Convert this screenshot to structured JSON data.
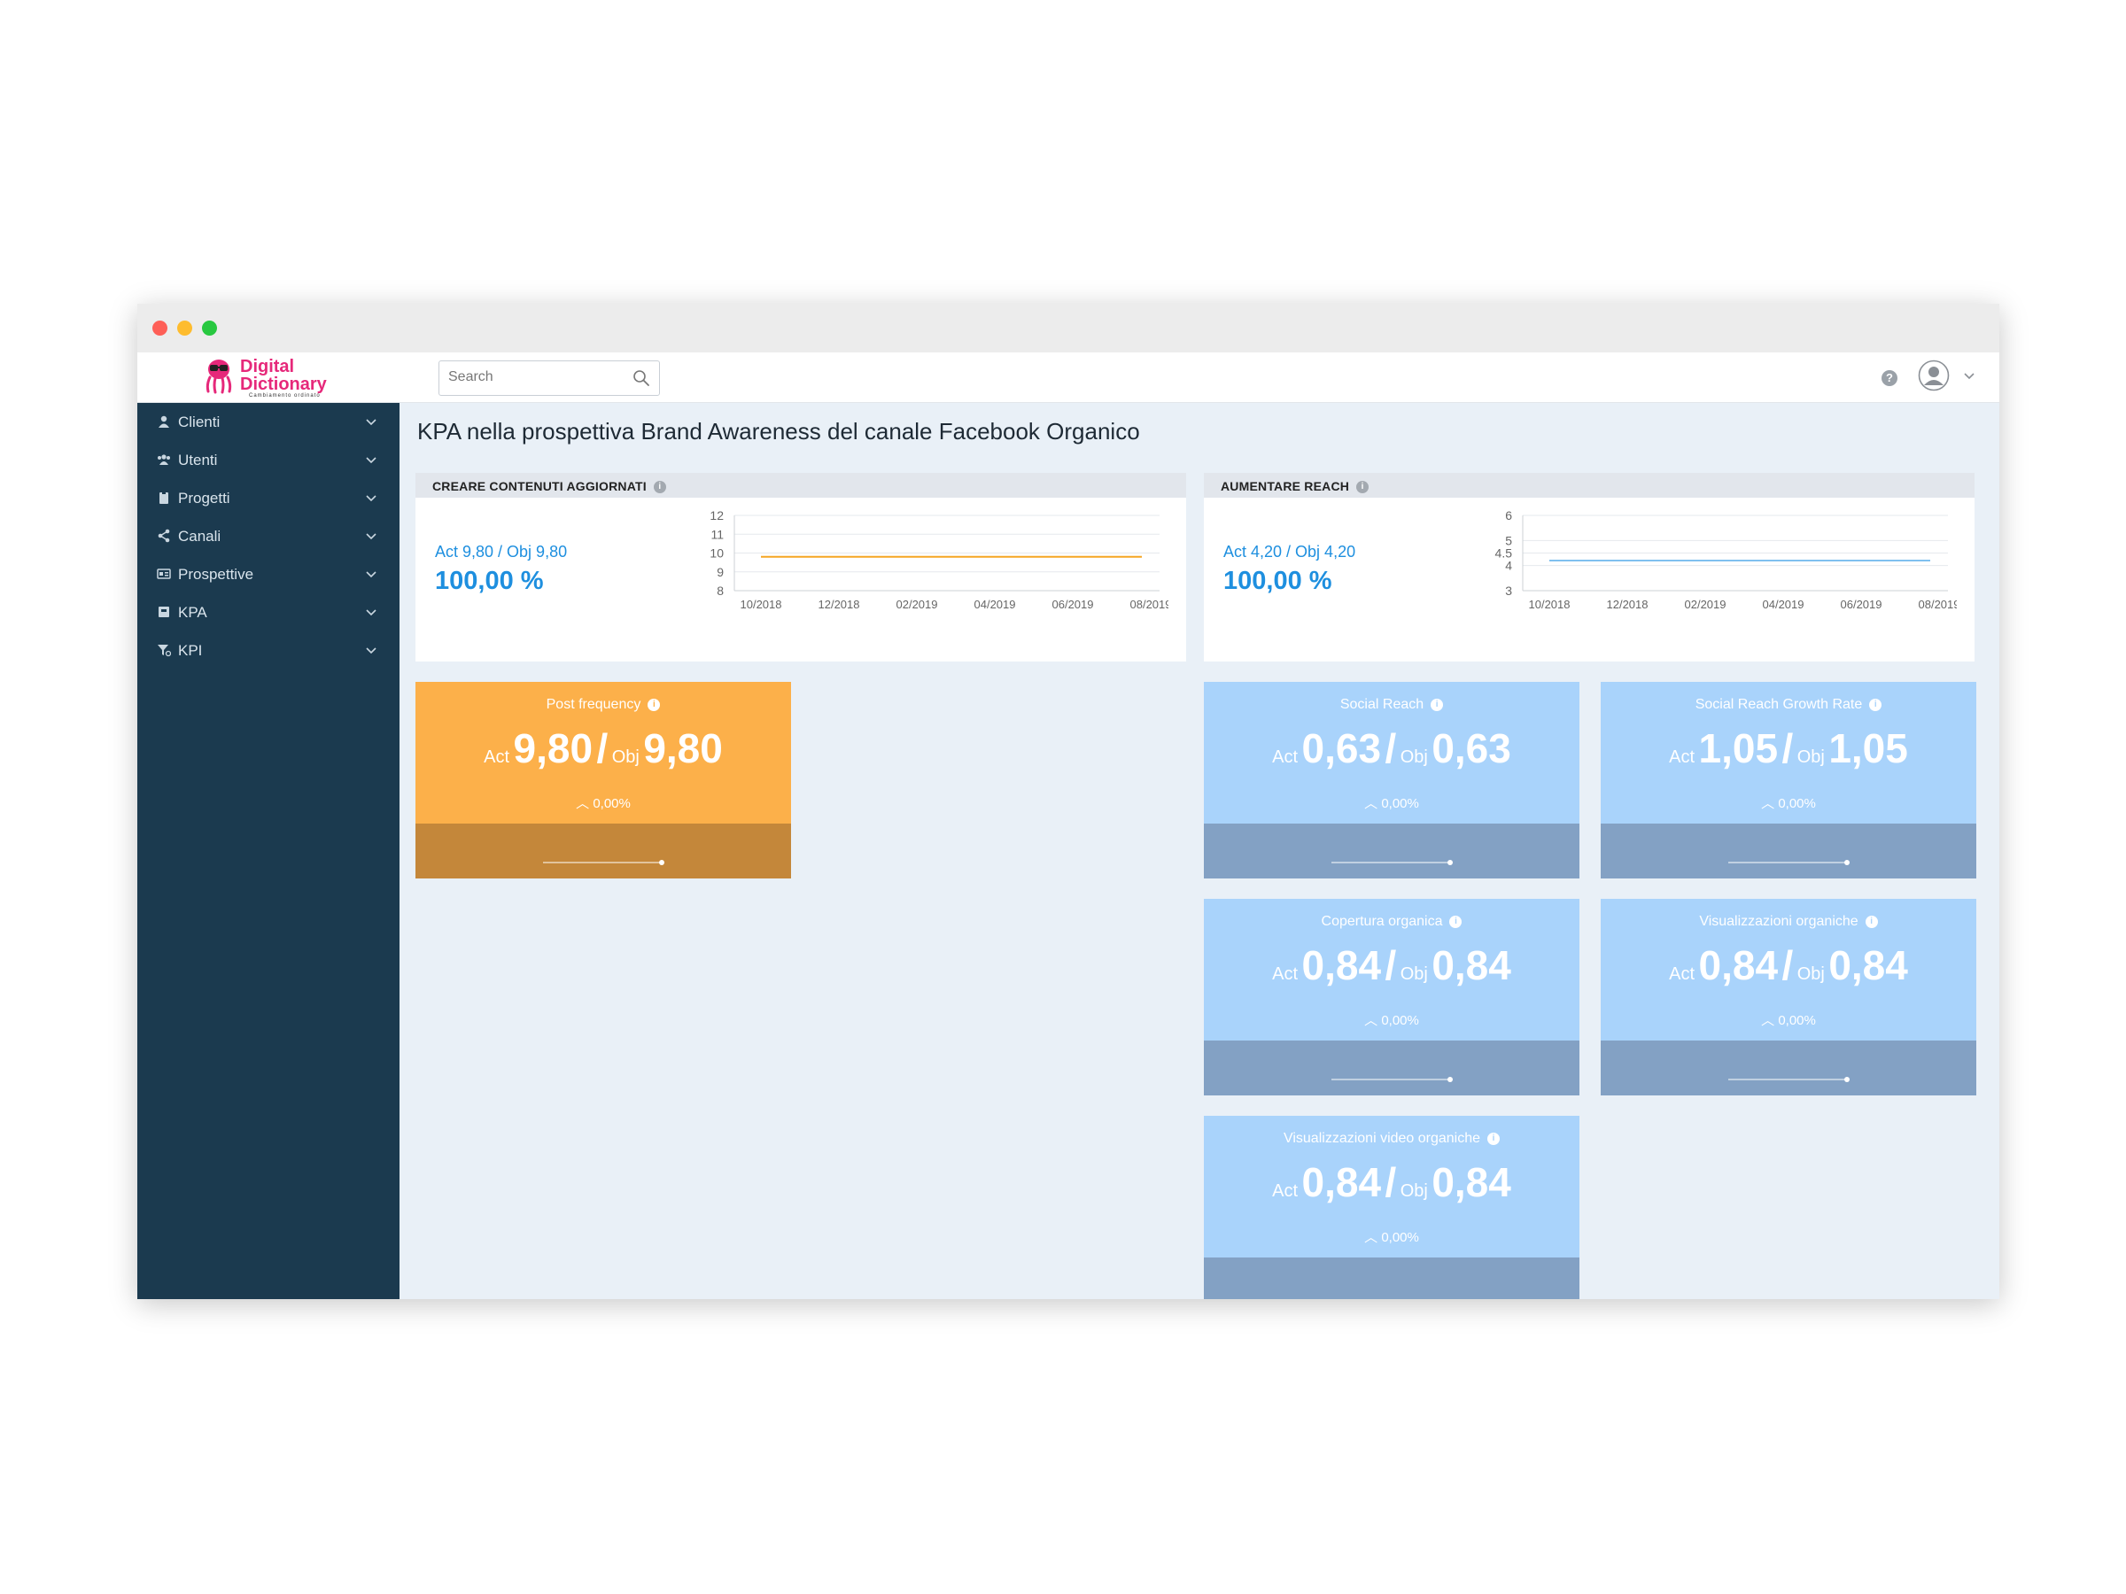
{
  "header": {
    "logo_line1": "Digital",
    "logo_line2": "Dictionary",
    "logo_tagline": "Cambiamento ordinato",
    "search_placeholder": "Search",
    "help_glyph": "?"
  },
  "sidebar": {
    "items": [
      {
        "label": "Clienti",
        "icon": "user-icon"
      },
      {
        "label": "Utenti",
        "icon": "users-icon"
      },
      {
        "label": "Progetti",
        "icon": "clipboard-icon"
      },
      {
        "label": "Canali",
        "icon": "share-icon"
      },
      {
        "label": "Prospettive",
        "icon": "id-card-icon"
      },
      {
        "label": "KPA",
        "icon": "book-icon"
      },
      {
        "label": "KPI",
        "icon": "funnel-icon"
      }
    ]
  },
  "page": {
    "title": "KPA nella prospettiva Brand Awareness del canale Facebook Organico"
  },
  "kpa_cards": [
    {
      "title": "CREARE CONTENUTI AGGIORNATI",
      "act_obj": "Act 9,80 / Obj 9,80",
      "percent": "100,00 %",
      "y_ticks": [
        "12",
        "11",
        "10",
        "9",
        "8"
      ],
      "x_ticks": [
        "10/2018",
        "12/2018",
        "02/2019",
        "04/2019",
        "06/2019",
        "08/2019"
      ],
      "line_color": "#f5a623"
    },
    {
      "title": "AUMENTARE REACH",
      "act_obj": "Act 4,20 / Obj 4,20",
      "percent": "100,00 %",
      "y_ticks": [
        "6",
        "5",
        "4.5",
        "4",
        "3"
      ],
      "x_ticks": [
        "10/2018",
        "12/2018",
        "02/2019",
        "04/2019",
        "06/2019",
        "08/2019"
      ],
      "line_color": "#7fc0ef"
    }
  ],
  "chart_data": [
    {
      "type": "line",
      "title": "CREARE CONTENUTI AGGIORNATI",
      "x": [
        "10/2018",
        "08/2019"
      ],
      "series": [
        {
          "values": [
            9.8,
            9.8
          ]
        }
      ],
      "ylim": [
        8,
        12
      ],
      "grid": true
    },
    {
      "type": "line",
      "title": "AUMENTARE REACH",
      "x": [
        "10/2018",
        "08/2019"
      ],
      "series": [
        {
          "values": [
            4.2,
            4.2
          ]
        }
      ],
      "ylim": [
        3,
        6
      ],
      "grid": true
    }
  ],
  "kpi_tiles": [
    {
      "name": "Post frequency",
      "act_label": "Act",
      "act": "9,80",
      "sep": "/",
      "obj_label": "Obj",
      "obj": "9,80",
      "delta": "0,00%",
      "color": "orange"
    },
    {
      "name": "Social Reach",
      "act_label": "Act",
      "act": "0,63",
      "sep": "/",
      "obj_label": "Obj",
      "obj": "0,63",
      "delta": "0,00%",
      "color": "blue"
    },
    {
      "name": "Social Reach Growth Rate",
      "act_label": "Act",
      "act": "1,05",
      "sep": "/",
      "obj_label": "Obj",
      "obj": "1,05",
      "delta": "0,00%",
      "color": "blue"
    },
    {
      "name": "Copertura organica",
      "act_label": "Act",
      "act": "0,84",
      "sep": "/",
      "obj_label": "Obj",
      "obj": "0,84",
      "delta": "0,00%",
      "color": "blue"
    },
    {
      "name": "Visualizzazioni organiche",
      "act_label": "Act",
      "act": "0,84",
      "sep": "/",
      "obj_label": "Obj",
      "obj": "0,84",
      "delta": "0,00%",
      "color": "blue"
    },
    {
      "name": "Visualizzazioni video organiche",
      "act_label": "Act",
      "act": "0,84",
      "sep": "/",
      "obj_label": "Obj",
      "obj": "0,84",
      "delta": "0,00%",
      "color": "blue"
    }
  ]
}
